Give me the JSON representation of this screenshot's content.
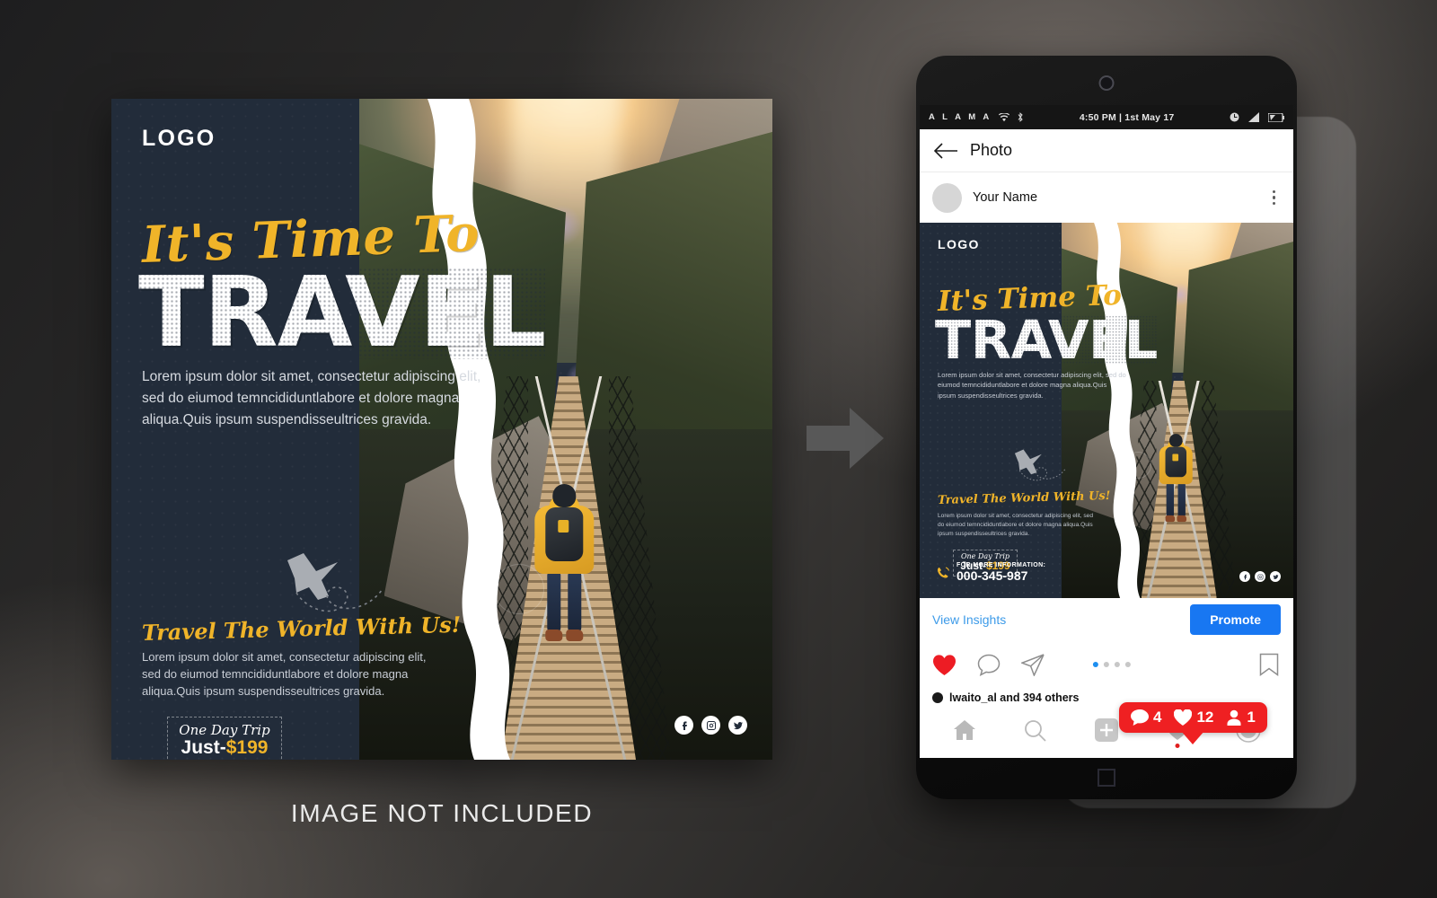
{
  "background_caption": "IMAGE NOT INCLUDED",
  "poster": {
    "logo": "LOGO",
    "headline_script": "It's Time To",
    "headline_main": "TRAVEL",
    "body_copy": "Lorem ipsum dolor sit amet, consectetur adipiscing elit, sed do eiumod temncididuntlabore et dolore magna aliqua.Quis ipsum suspendisseultrices gravida.",
    "subheading": "Travel The World With Us!",
    "sub_copy": "Lorem ipsum dolor sit amet, consectetur adipiscing elit, sed do eiumod temncididuntlabore et dolore magna aliqua.Quis ipsum suspendisseultrices gravida.",
    "price_script": "One Day Trip",
    "price_prefix": "Just-",
    "price_amount": "$199",
    "contact_label": "FOR MORE INFORMATION:",
    "contact_number": "000-345-987",
    "socials": [
      "facebook-icon",
      "instagram-icon",
      "twitter-icon"
    ],
    "accent_color": "#f0b429",
    "panel_color": "#222c3a"
  },
  "arrow": {
    "name": "right-arrow-icon",
    "color": "#585858"
  },
  "phone": {
    "statusbar": {
      "carrier": "A L A M A",
      "wifi_icon": "wifi-icon",
      "bluetooth_icon": "bluetooth-icon",
      "time_date": "4:50 PM | 1st May 17",
      "alarm_icon": "clock-icon",
      "signal_icon": "signal-icon",
      "battery_icon": "battery-icon"
    },
    "app_header": {
      "back_icon": "back-arrow-icon",
      "title": "Photo"
    },
    "post_header": {
      "avatar": "avatar",
      "username": "Your Name",
      "menu_icon": "kebab-menu-icon"
    },
    "insights": {
      "link_label": "View Insights",
      "promote_label": "Promote",
      "promote_color": "#1877f2"
    },
    "actions": {
      "like_icon": "heart-filled-icon",
      "comment_icon": "comment-icon",
      "share_icon": "share-paperplane-icon",
      "save_icon": "bookmark-icon",
      "carousel_dots": 4,
      "carousel_active": 0
    },
    "notification": {
      "comments": "4",
      "likes": "12",
      "followers": "1",
      "badge_color": "#ef2022"
    },
    "likes_line": "lwaito_al  and 394 others",
    "navbar": {
      "home_icon": "home-icon",
      "search_icon": "search-icon",
      "add_icon": "plus-square-icon",
      "activity_icon": "heart-icon",
      "profile_icon": "profile-circle-icon"
    },
    "home_button": "home-square-button"
  }
}
